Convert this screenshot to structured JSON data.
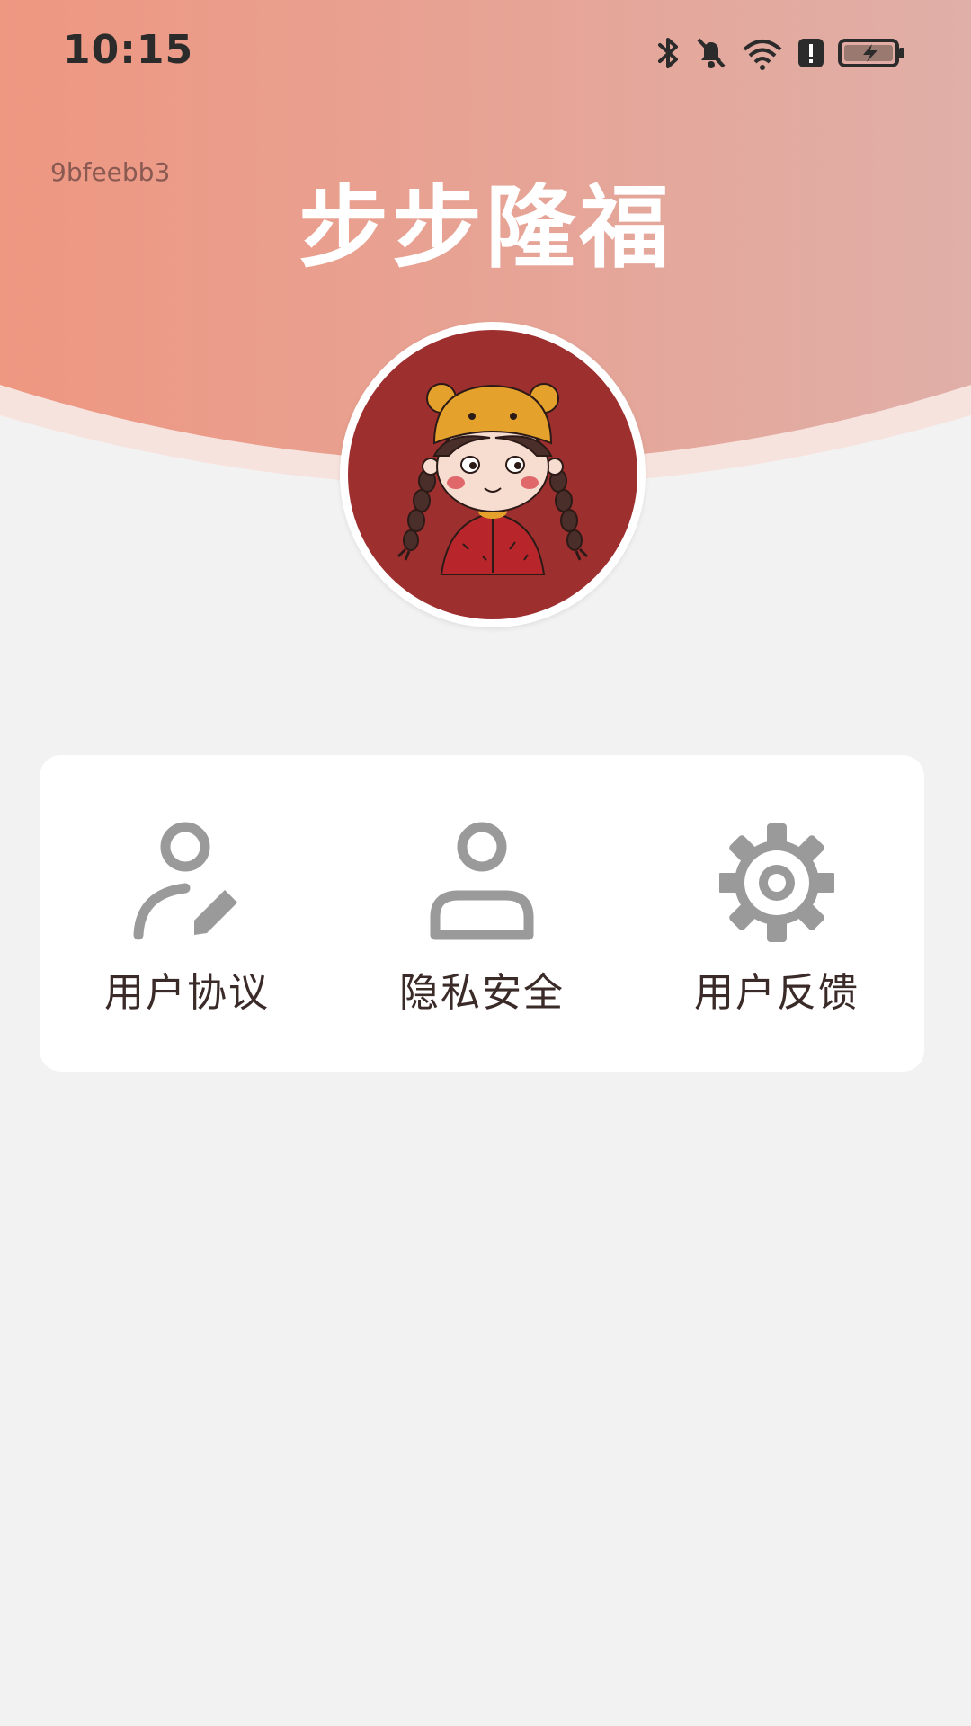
{
  "status_bar": {
    "time": "10:15",
    "icons": [
      "bluetooth-icon",
      "mute-notifications-icon",
      "wifi-icon",
      "alert-icon",
      "battery-charging-icon"
    ]
  },
  "header": {
    "device_id": "9bfeebb3",
    "title": "步步隆福",
    "gradient_start": "#ee9781",
    "gradient_end": "#e0afa8"
  },
  "menu": {
    "items": [
      {
        "label": "用户协议",
        "icon": "user-edit-icon"
      },
      {
        "label": "隐私安全",
        "icon": "user-icon"
      },
      {
        "label": "用户反馈",
        "icon": "gear-icon"
      }
    ]
  },
  "colors": {
    "background": "#f2f2f2",
    "card": "#ffffff",
    "icon_gray": "#9a9a9a",
    "label_text": "#3a2a28",
    "avatar_bg": "#9e2f2f"
  }
}
